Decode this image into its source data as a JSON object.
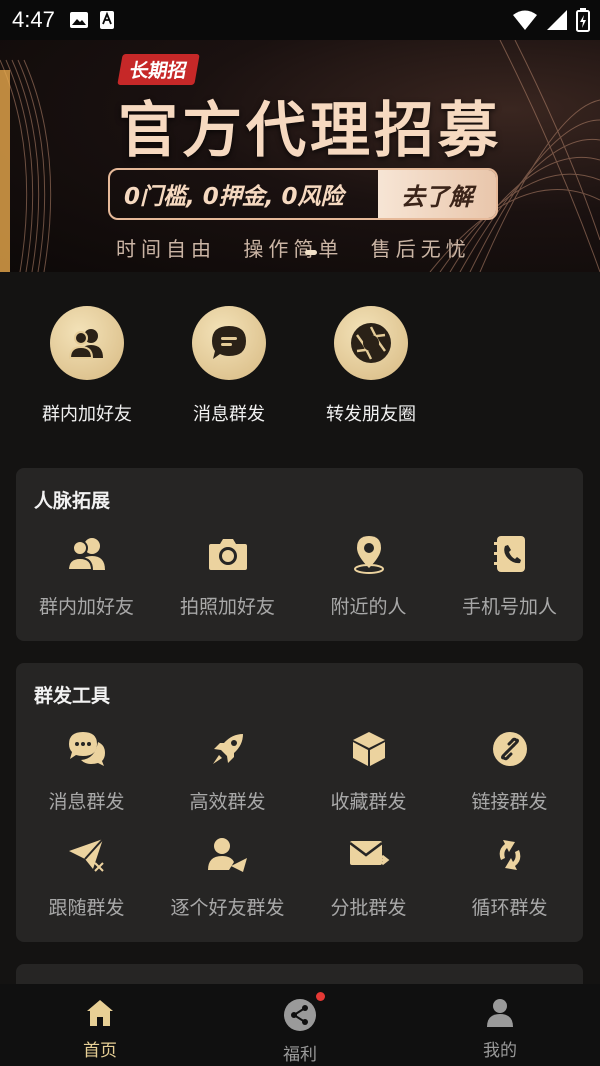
{
  "status_bar": {
    "time": "4:47"
  },
  "banner": {
    "tag": "长期招",
    "headline": "官方代理招募",
    "pill_text": "0门槛, 0押金, 0风险",
    "pill_button": "去了解",
    "subtitle": "时间自由  操作简单  售后无忧"
  },
  "quick_actions": [
    {
      "label": "群内加好友",
      "icon": "group-users-icon"
    },
    {
      "label": "消息群发",
      "icon": "chat-bubble-icon"
    },
    {
      "label": "转发朋友圈",
      "icon": "camera-shutter-icon"
    }
  ],
  "network_card": {
    "title": "人脉拓展",
    "items": [
      {
        "label": "群内加好友",
        "icon": "users-icon"
      },
      {
        "label": "拍照加好友",
        "icon": "camera-icon"
      },
      {
        "label": "附近的人",
        "icon": "location-pin-icon"
      },
      {
        "label": "手机号加人",
        "icon": "phone-book-icon"
      }
    ]
  },
  "broadcast_card": {
    "title": "群发工具",
    "items": [
      {
        "label": "消息群发",
        "icon": "chat-bubbles-icon"
      },
      {
        "label": "高效群发",
        "icon": "rocket-icon"
      },
      {
        "label": "收藏群发",
        "icon": "box-icon"
      },
      {
        "label": "链接群发",
        "icon": "link-icon"
      },
      {
        "label": "跟随群发",
        "icon": "paper-plane-shuffle-icon"
      },
      {
        "label": "逐个好友群发",
        "icon": "user-send-icon"
      },
      {
        "label": "分批群发",
        "icon": "mail-forward-icon"
      },
      {
        "label": "循环群发",
        "icon": "loop-icon"
      }
    ]
  },
  "tabs": [
    {
      "label": "首页",
      "icon": "home-icon",
      "active": true
    },
    {
      "label": "福利",
      "icon": "share-icon",
      "active": false
    },
    {
      "label": "我的",
      "icon": "profile-icon",
      "active": false
    }
  ],
  "colors": {
    "gold": "#e7cf95",
    "background": "#141312",
    "card": "#262524",
    "badge_red": "#e53935"
  }
}
